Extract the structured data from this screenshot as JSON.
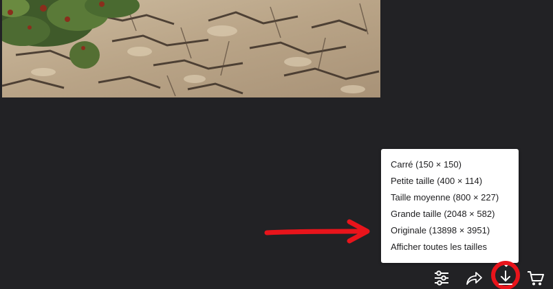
{
  "photo": {
    "subject": "rocky limestone outcrop with green shrubs"
  },
  "download_menu": {
    "items": [
      {
        "label": "Carré (150 × 150)"
      },
      {
        "label": "Petite taille (400 × 114)"
      },
      {
        "label": "Taille moyenne (800 × 227)"
      },
      {
        "label": "Grande taille (2048 × 582)"
      },
      {
        "label": "Originale (13898 × 3951)"
      },
      {
        "label": "Afficher toutes les tailles"
      }
    ]
  },
  "toolbar": {
    "buttons": [
      {
        "icon": "sliders-icon"
      },
      {
        "icon": "share-arrow-icon"
      },
      {
        "icon": "download-icon"
      },
      {
        "icon": "cart-icon"
      }
    ]
  },
  "annotations": {
    "color": "#e8141b"
  },
  "colors": {
    "background": "#222225",
    "menu_background": "#ffffff",
    "icon": "#ffffff"
  }
}
